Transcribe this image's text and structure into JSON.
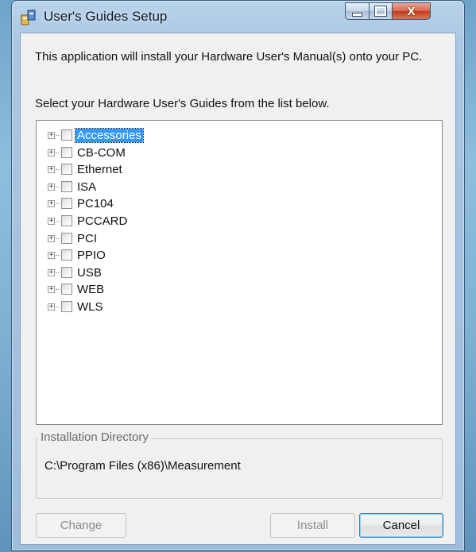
{
  "window": {
    "title": "User's Guides Setup"
  },
  "intro": {
    "line1": "This application will install your Hardware User's Manual(s) onto your PC.",
    "line2": "Select your Hardware User's Guides from the list below."
  },
  "tree": {
    "items": [
      {
        "label": "Accessories",
        "selected": true
      },
      {
        "label": "CB-COM",
        "selected": false
      },
      {
        "label": "Ethernet",
        "selected": false
      },
      {
        "label": "ISA",
        "selected": false
      },
      {
        "label": "PC104",
        "selected": false
      },
      {
        "label": "PCCARD",
        "selected": false
      },
      {
        "label": "PCI",
        "selected": false
      },
      {
        "label": "PPIO",
        "selected": false
      },
      {
        "label": "USB",
        "selected": false
      },
      {
        "label": "WEB",
        "selected": false
      },
      {
        "label": "WLS",
        "selected": false
      }
    ],
    "expander_glyph": "+"
  },
  "install_dir": {
    "legend": "Installation Directory",
    "path": "C:\\Program Files (x86)\\Measurement"
  },
  "buttons": {
    "change": "Change",
    "install": "Install",
    "cancel": "Cancel"
  },
  "controls": {
    "close_glyph": "X"
  }
}
